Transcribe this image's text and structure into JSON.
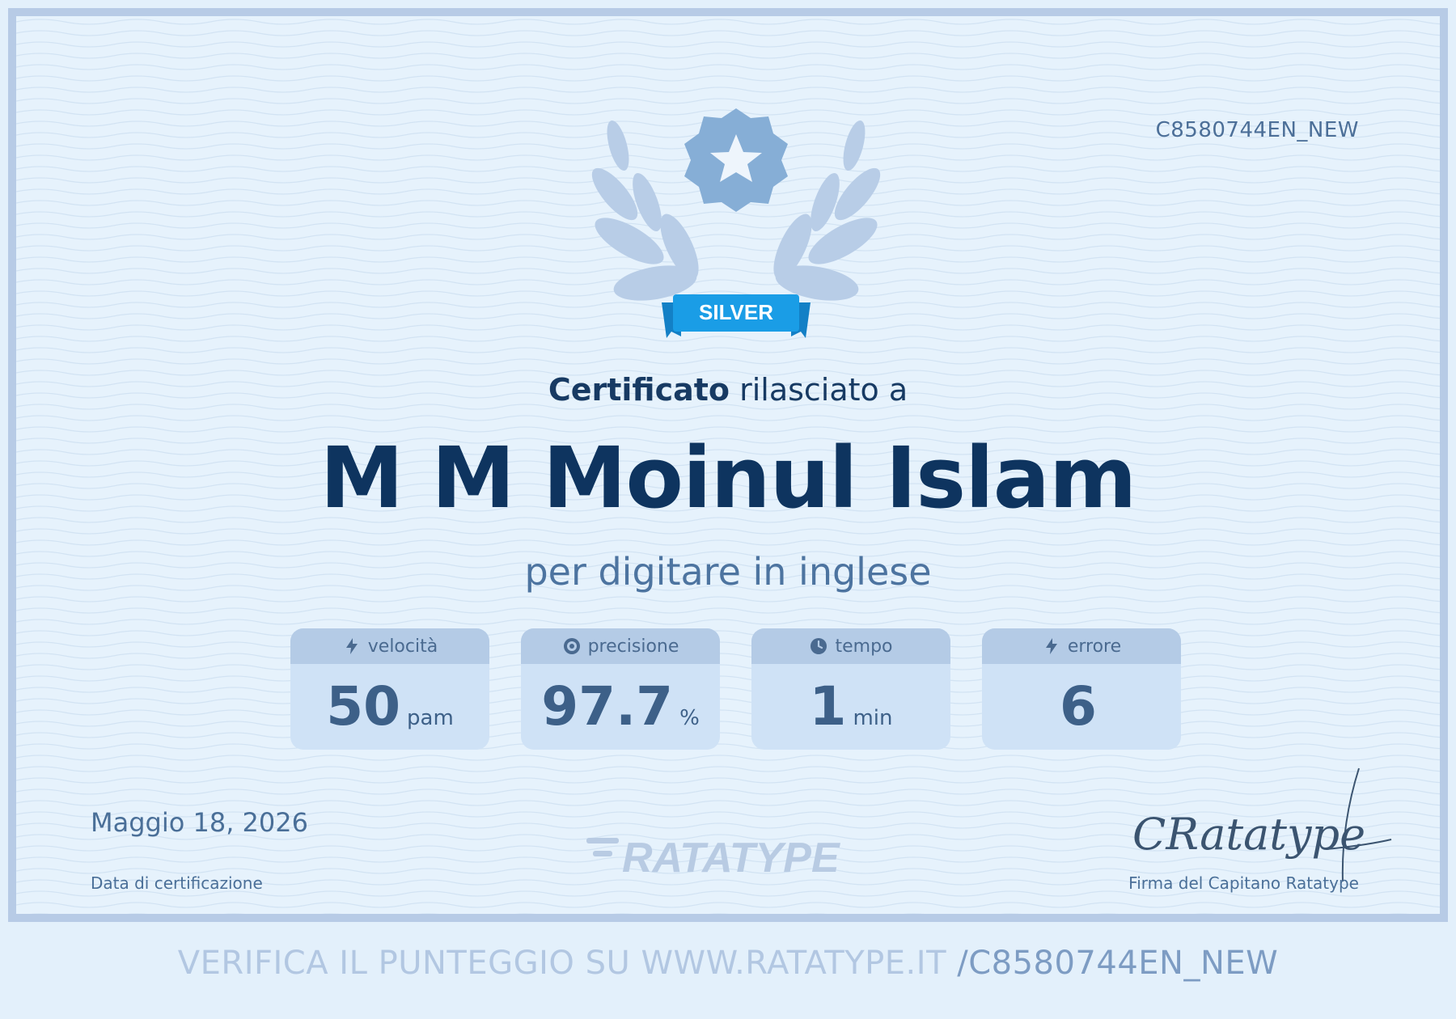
{
  "certificate": {
    "id": "C8580744EN_NEW",
    "badge_label": "SILVER",
    "heading_strong": "Certificato",
    "heading_rest": " rilasciato a",
    "recipient": "M M Moinul Islam",
    "subject": "per digitare in inglese",
    "date": "Maggio 18, 2026",
    "date_label": "Data di certificazione",
    "logo_text": "RATATYPE",
    "signature_text": "CRatatype",
    "signature_label": "Firma del Capitano Ratatype"
  },
  "stats": [
    {
      "icon": "lightning-icon",
      "label": "velocità",
      "value": "50",
      "unit": "pam"
    },
    {
      "icon": "target-icon",
      "label": "precisione",
      "value": "97.7",
      "unit": "%"
    },
    {
      "icon": "clock-icon",
      "label": "tempo",
      "value": "1",
      "unit": "min"
    },
    {
      "icon": "lightning-icon",
      "label": "errore",
      "value": "6",
      "unit": ""
    }
  ],
  "verify": {
    "prefix": "VERIFICA IL PUNTEGGIO SU WWW.RATATYPE.IT ",
    "code": "/C8580744EN_NEW"
  },
  "colors": {
    "badge_blue": "#1a9de6",
    "star_seal": "#86aed6",
    "laurel": "#b7cde7",
    "name_navy": "#0e345f"
  }
}
